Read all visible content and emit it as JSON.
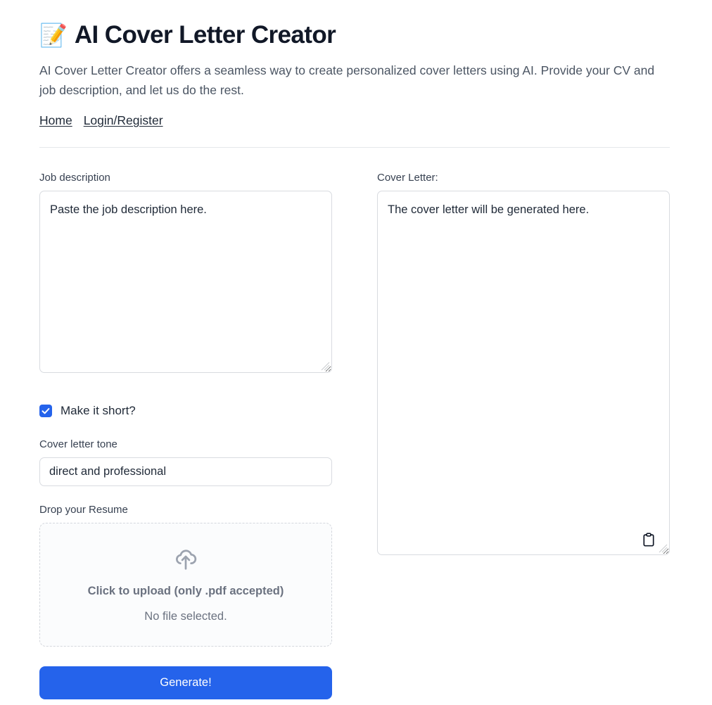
{
  "header": {
    "emoji": "📝",
    "emoji_name": "memo-emoji",
    "title": "AI Cover Letter Creator",
    "intro": "AI Cover Letter Creator offers a seamless way to create personalized cover letters using AI. Provide your CV and job description, and let us do the rest.",
    "nav": [
      {
        "label": "Home"
      },
      {
        "label": "Login/Register"
      }
    ]
  },
  "form": {
    "job_description": {
      "label": "Job description",
      "placeholder": "Paste the job description here.",
      "value": ""
    },
    "make_it_short": {
      "label": "Make it short?",
      "checked": true
    },
    "tone": {
      "label": "Cover letter tone",
      "value": "direct and professional",
      "placeholder": "direct and professional"
    },
    "resume_upload": {
      "label": "Drop your Resume",
      "icon": "cloud-upload-icon",
      "cta": "Click to upload (only .pdf accepted)",
      "status": "No file selected."
    },
    "submit": {
      "label": "Generate!"
    }
  },
  "output": {
    "label": "Cover Letter:",
    "placeholder": "The cover letter will be generated here.",
    "value": "",
    "copy_icon": "clipboard-icon"
  },
  "colors": {
    "accent": "#2563EB",
    "text": "#1F2937",
    "muted": "#6B7280",
    "border": "#D8DBE0",
    "divider": "#E5E7EB",
    "dropzone_bg": "#FBFCFD"
  }
}
